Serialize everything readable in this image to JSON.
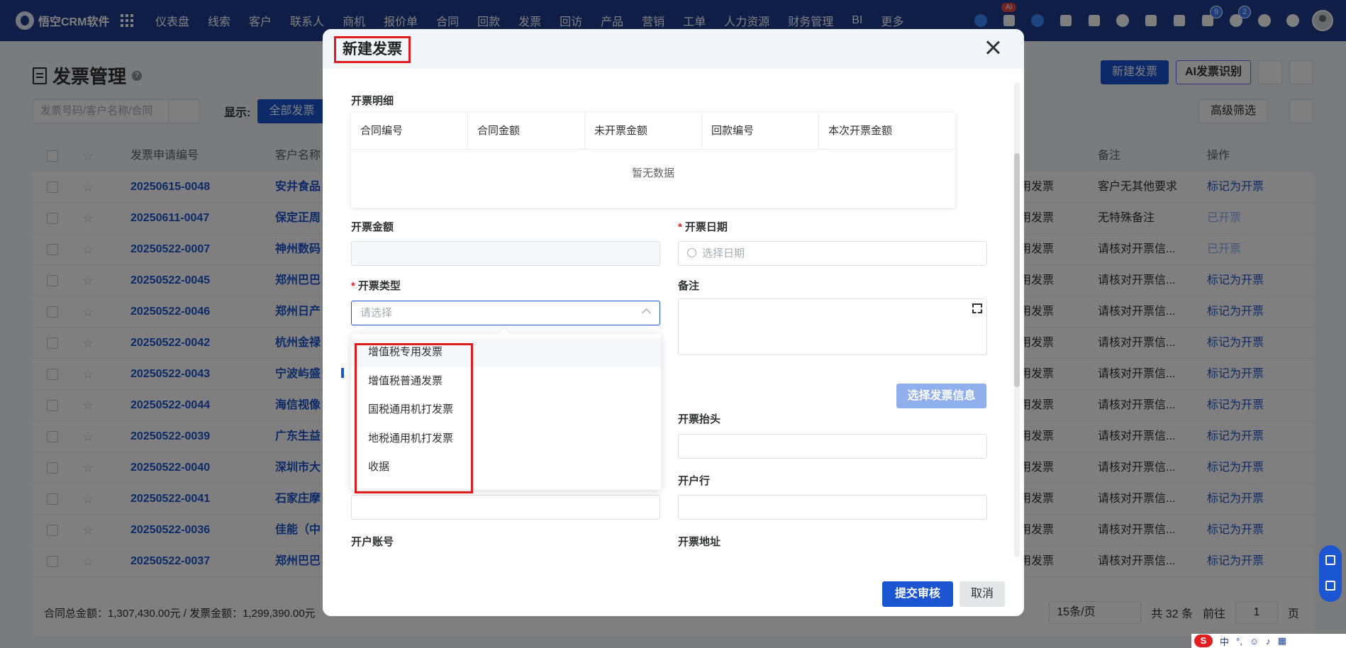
{
  "app": {
    "brand": "悟空CRM软件",
    "nav": [
      "仪表盘",
      "线索",
      "客户",
      "联系人",
      "商机",
      "报价单",
      "合同",
      "回款",
      "发票",
      "回访",
      "产品",
      "营销",
      "工单",
      "人力资源",
      "财务管理",
      "BI",
      "更多"
    ],
    "ai_badge": "AI",
    "badge_a": "9",
    "badge_b": "2"
  },
  "page": {
    "title": "发票管理",
    "new_button": "新建发票",
    "ai_button": "AI发票识别",
    "search_placeholder": "发票号码/客户名称/合同",
    "show_label": "显示:",
    "show_value": "全部发票",
    "filter_button": "高级筛选",
    "columns": {
      "id": "发票申请编号",
      "customer": "客户名称",
      "note": "备注",
      "op": "操作"
    },
    "rows": [
      {
        "id": "20250615-0048",
        "cust": "安井食品",
        "type": "用发票",
        "note": "客户无其他要求",
        "op": "标记为开票",
        "done": false
      },
      {
        "id": "20250611-0047",
        "cust": "保定正周",
        "type": "用发票",
        "note": "无特殊备注",
        "op": "已开票",
        "done": true
      },
      {
        "id": "20250522-0007",
        "cust": "神州数码",
        "type": "用发票",
        "note": "请核对开票信...",
        "op": "已开票",
        "done": true
      },
      {
        "id": "20250522-0045",
        "cust": "郑州巴巴",
        "type": "用发票",
        "note": "请核对开票信...",
        "op": "标记为开票",
        "done": false
      },
      {
        "id": "20250522-0046",
        "cust": "郑州日产",
        "type": "用发票",
        "note": "请核对开票信...",
        "op": "标记为开票",
        "done": false
      },
      {
        "id": "20250522-0042",
        "cust": "杭州金禄",
        "type": "用发票",
        "note": "请核对开票信...",
        "op": "标记为开票",
        "done": false
      },
      {
        "id": "20250522-0043",
        "cust": "宁波屿盛",
        "type": "用发票",
        "note": "请核对开票信...",
        "op": "标记为开票",
        "done": false
      },
      {
        "id": "20250522-0044",
        "cust": "海信视像",
        "type": "用发票",
        "note": "请核对开票信...",
        "op": "标记为开票",
        "done": false
      },
      {
        "id": "20250522-0039",
        "cust": "广东生益",
        "type": "用发票",
        "note": "请核对开票信...",
        "op": "标记为开票",
        "done": false
      },
      {
        "id": "20250522-0040",
        "cust": "深圳市大",
        "type": "用发票",
        "note": "请核对开票信...",
        "op": "标记为开票",
        "done": false
      },
      {
        "id": "20250522-0041",
        "cust": "石家庄摩",
        "type": "用发票",
        "note": "请核对开票信...",
        "op": "标记为开票",
        "done": false
      },
      {
        "id": "20250522-0036",
        "cust": "佳能（中",
        "type": "用发票",
        "note": "请核对开票信...",
        "op": "标记为开票",
        "done": false
      },
      {
        "id": "20250522-0037",
        "cust": "郑州巴巴",
        "type": "用发票",
        "note": "请核对开票信...",
        "op": "标记为开票",
        "done": false
      }
    ],
    "footer_sum": "合同总金额：1,307,430.00元 / 发票金额：1,299,390.00元",
    "page_size": "15条/页",
    "total": "共 32 条",
    "goto_label": "前往",
    "goto_value": "1",
    "page_unit": "页"
  },
  "modal": {
    "title": "新建发票",
    "detail_label": "开票明细",
    "detail_columns": [
      "合同编号",
      "合同金额",
      "未开票金额",
      "回款编号",
      "本次开票金额"
    ],
    "detail_empty": "暂无数据",
    "amount_label": "开票金额",
    "amount_value": "",
    "date_label": "开票日期",
    "date_placeholder": "选择日期",
    "type_label": "开票类型",
    "type_placeholder": "请选择",
    "note_label": "备注",
    "type_options": [
      "增值税专用发票",
      "增值税普通发票",
      "国税通用机打发票",
      "地税通用机打发票",
      "收据"
    ],
    "choose_button": "选择发票信息",
    "title_label": "开票抬头",
    "bank_label": "开户行",
    "account_label": "开户账号",
    "address_label": "开票地址",
    "submit_button": "提交审核",
    "cancel_button": "取消"
  },
  "colors": {
    "nav_bg": "#1e3d8f",
    "primary": "#1b55d1",
    "highlight": "#e01b1b"
  }
}
